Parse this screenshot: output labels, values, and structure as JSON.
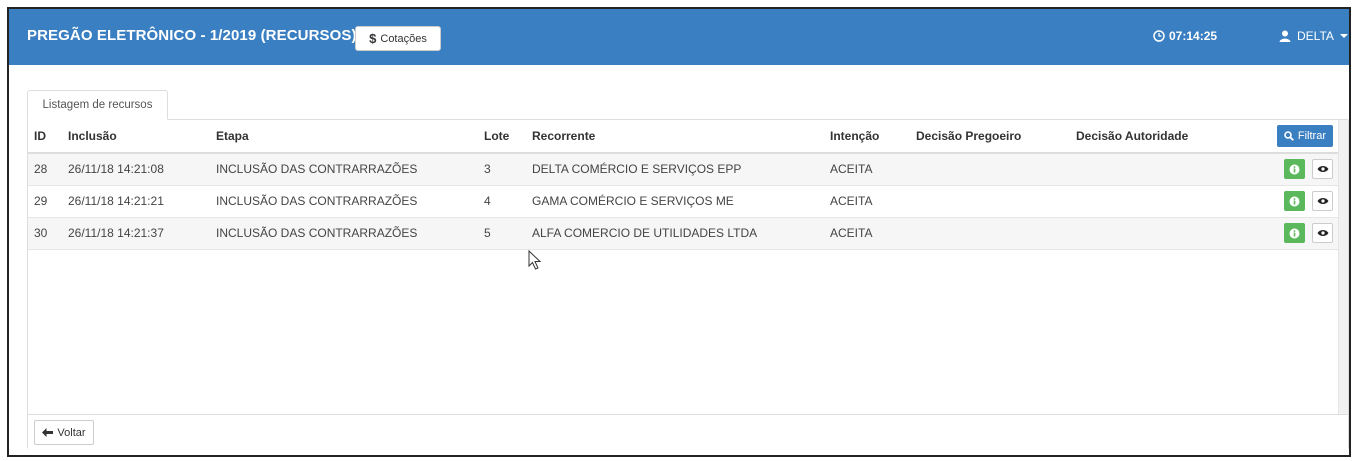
{
  "header": {
    "title": "PREGÃO ELETRÔNICO - 1/2019 (RECURSOS)",
    "cotacoes_label": "Cotações",
    "clock": "07:14:25",
    "user": "DELTA"
  },
  "tab": {
    "label": "Listagem de recursos"
  },
  "table": {
    "columns": [
      "ID",
      "Inclusão",
      "Etapa",
      "Lote",
      "Recorrente",
      "Intenção",
      "Decisão Pregoeiro",
      "Decisão Autoridade"
    ],
    "filter_label": "Filtrar",
    "rows": [
      {
        "id": "28",
        "inclusao": "26/11/18 14:21:08",
        "etapa": "INCLUSÃO DAS CONTRARRAZÕES",
        "lote": "3",
        "recorrente": "DELTA COMÉRCIO E SERVIÇOS EPP",
        "intencao": "ACEITA",
        "dp": "",
        "da": ""
      },
      {
        "id": "29",
        "inclusao": "26/11/18 14:21:21",
        "etapa": "INCLUSÃO DAS CONTRARRAZÕES",
        "lote": "4",
        "recorrente": "GAMA COMÉRCIO E SERVIÇOS ME",
        "intencao": "ACEITA",
        "dp": "",
        "da": ""
      },
      {
        "id": "30",
        "inclusao": "26/11/18 14:21:37",
        "etapa": "INCLUSÃO DAS CONTRARRAZÕES",
        "lote": "5",
        "recorrente": "ALFA COMERCIO DE UTILIDADES LTDA",
        "intencao": "ACEITA",
        "dp": "",
        "da": ""
      }
    ]
  },
  "footer": {
    "voltar_label": "Voltar"
  },
  "colors": {
    "header_bg": "#3a7fc1",
    "action_green": "#5cb85c"
  }
}
